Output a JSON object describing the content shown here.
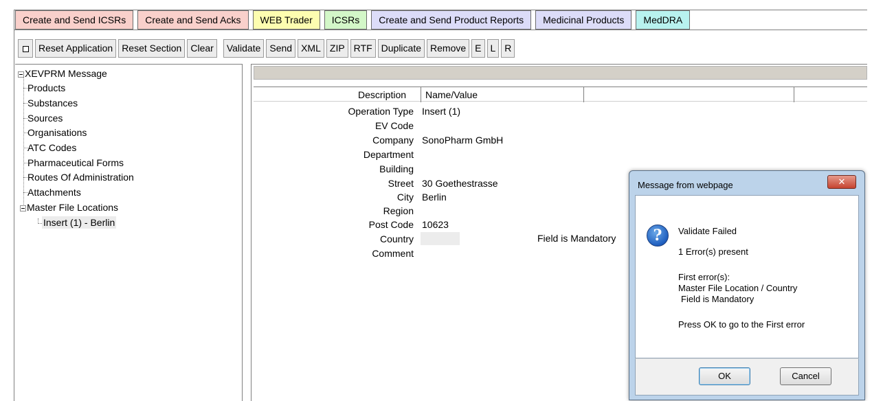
{
  "tabs": [
    {
      "label": "Create and Send ICSRs",
      "color": "#f9d0cb"
    },
    {
      "label": "Create and Send Acks",
      "color": "#f9d0cb"
    },
    {
      "label": "WEB Trader",
      "color": "#fdfdb0"
    },
    {
      "label": "ICSRs",
      "color": "#d3f7c8"
    },
    {
      "label": "Create and Send Product Reports",
      "color": "#dcdcf8"
    },
    {
      "label": "Medicinal Products",
      "color": "#dcdcf8"
    },
    {
      "label": "MedDRA",
      "color": "#b8f2ef"
    }
  ],
  "toolbar": {
    "toggle_icon": "square-icon",
    "reset_application": "Reset Application",
    "reset_section": "Reset Section",
    "clear": "Clear",
    "validate": "Validate",
    "send": "Send",
    "xml": "XML",
    "zip": "ZIP",
    "rtf": "RTF",
    "duplicate": "Duplicate",
    "remove": "Remove",
    "e": "E",
    "l": "L",
    "r": "R"
  },
  "tree": {
    "root": "XEVPRM Message",
    "items": [
      "Products",
      "Substances",
      "Sources",
      "Organisations",
      "ATC Codes",
      "Pharmaceutical Forms",
      "Routes Of Administration",
      "Attachments"
    ],
    "master": "Master File Locations",
    "child": "Insert (1) - Berlin"
  },
  "grid": {
    "col_description": "Description",
    "col_name_value": "Name/Value",
    "rows": [
      {
        "label": "Operation Type",
        "value": "Insert (1)"
      },
      {
        "label": "EV Code",
        "value": ""
      },
      {
        "label": "Company",
        "value": "SonoPharm GmbH"
      },
      {
        "label": "Department",
        "value": ""
      },
      {
        "label": "Building",
        "value": ""
      },
      {
        "label": "Street",
        "value": "30 Goethestrasse"
      },
      {
        "label": "City",
        "value": "Berlin"
      },
      {
        "label": "Region",
        "value": ""
      },
      {
        "label": "Post Code",
        "value": "10623"
      },
      {
        "label": "Country",
        "value": ""
      },
      {
        "label": "Comment",
        "value": ""
      }
    ],
    "country_error": "Field is Mandatory"
  },
  "dialog": {
    "title": "Message from webpage",
    "close_icon": "close-icon",
    "icon": "question-icon",
    "heading": "Validate Failed",
    "count": "1 Error(s) present",
    "first_errors": "First error(s):",
    "error_path": "Master File Location / Country",
    "error_msg": "Field is Mandatory",
    "hint": "Press OK to go to the First error",
    "ok": "OK",
    "cancel": "Cancel"
  }
}
